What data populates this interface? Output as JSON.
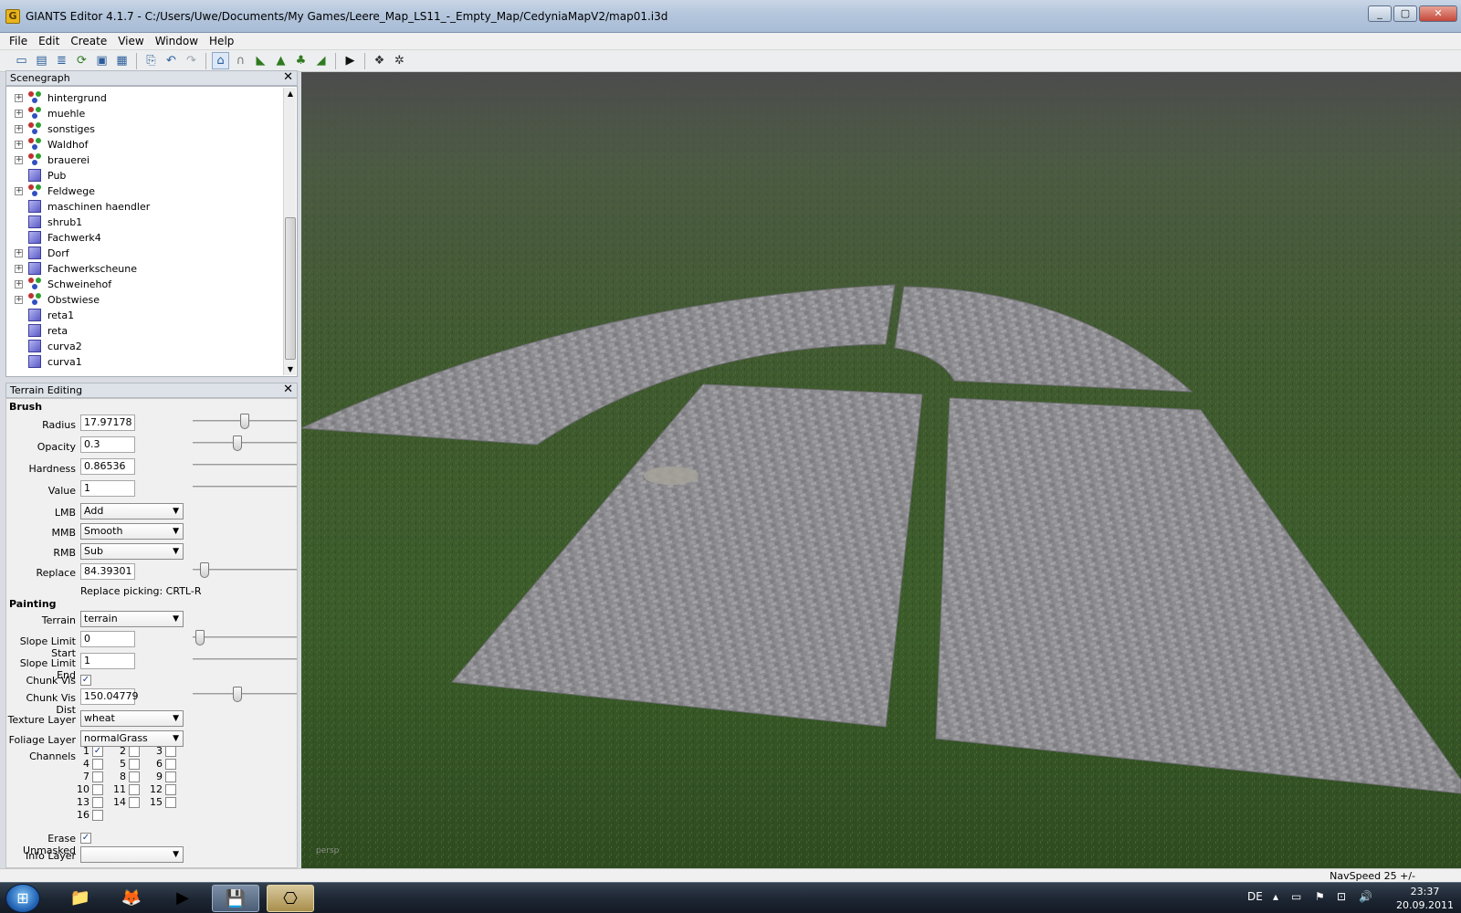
{
  "window": {
    "title": "GIANTS Editor 4.1.7 - C:/Users/Uwe/Documents/My Games/Leere_Map_LS11_-_Empty_Map/CedyniaMapV2/map01.i3d",
    "app_icon": "G"
  },
  "menu": [
    "File",
    "Edit",
    "Create",
    "View",
    "Window",
    "Help"
  ],
  "scenegraph": {
    "title": "Scenegraph",
    "items": [
      {
        "label": "hintergrund",
        "type": "group",
        "expandable": true
      },
      {
        "label": "muehle",
        "type": "group",
        "expandable": true
      },
      {
        "label": "sonstiges",
        "type": "group",
        "expandable": true
      },
      {
        "label": "Waldhof",
        "type": "group",
        "expandable": true
      },
      {
        "label": "brauerei",
        "type": "group",
        "expandable": true
      },
      {
        "label": "Pub",
        "type": "cube",
        "expandable": false
      },
      {
        "label": "Feldwege",
        "type": "group",
        "expandable": true
      },
      {
        "label": "maschinen haendler",
        "type": "cube",
        "expandable": false
      },
      {
        "label": "shrub1",
        "type": "cube",
        "expandable": false
      },
      {
        "label": "Fachwerk4",
        "type": "cube",
        "expandable": false
      },
      {
        "label": "Dorf",
        "type": "cube",
        "expandable": true
      },
      {
        "label": "Fachwerkscheune",
        "type": "cube",
        "expandable": true
      },
      {
        "label": "Schweinehof",
        "type": "group",
        "expandable": true
      },
      {
        "label": "Obstwiese",
        "type": "group",
        "expandable": true
      },
      {
        "label": "reta1",
        "type": "cube",
        "expandable": false
      },
      {
        "label": "reta",
        "type": "cube",
        "expandable": false
      },
      {
        "label": "curva2",
        "type": "cube",
        "expandable": false
      },
      {
        "label": "curva1",
        "type": "cube",
        "expandable": false
      }
    ]
  },
  "terrain": {
    "title": "Terrain Editing",
    "brush_title": "Brush",
    "painting_title": "Painting",
    "radius": {
      "label": "Radius",
      "value": "17.97178"
    },
    "opacity": {
      "label": "Opacity",
      "value": "0.3"
    },
    "hardness": {
      "label": "Hardness",
      "value": "0.86536"
    },
    "value": {
      "label": "Value",
      "value": "1"
    },
    "lmb": {
      "label": "LMB",
      "value": "Add"
    },
    "mmb": {
      "label": "MMB",
      "value": "Smooth"
    },
    "rmb": {
      "label": "RMB",
      "value": "Sub"
    },
    "replace": {
      "label": "Replace",
      "value": "84.39301"
    },
    "replace_hint": "Replace picking: CRTL-R",
    "terrain_layer": {
      "label": "Terrain",
      "value": "terrain"
    },
    "slope_start": {
      "label": "Slope Limit Start",
      "value": "0"
    },
    "slope_end": {
      "label": "Slope Limit End",
      "value": "1"
    },
    "chunk_vis": {
      "label": "Chunk Vis",
      "checked": true
    },
    "chunk_vis_dist": {
      "label": "Chunk Vis Dist",
      "value": "150.04779"
    },
    "texture_layer": {
      "label": "Texture Layer",
      "value": "wheat"
    },
    "foliage_layer": {
      "label": "Foliage Layer",
      "value": "normalGrass"
    },
    "channels_label": "Channels",
    "channels": [
      {
        "n": "1",
        "checked": true
      },
      {
        "n": "2",
        "checked": false
      },
      {
        "n": "3",
        "checked": false
      },
      {
        "n": "4",
        "checked": false
      },
      {
        "n": "5",
        "checked": false
      },
      {
        "n": "6",
        "checked": false
      },
      {
        "n": "7",
        "checked": false
      },
      {
        "n": "8",
        "checked": false
      },
      {
        "n": "9",
        "checked": false
      },
      {
        "n": "10",
        "checked": false
      },
      {
        "n": "11",
        "checked": false
      },
      {
        "n": "12",
        "checked": false
      },
      {
        "n": "13",
        "checked": false
      },
      {
        "n": "14",
        "checked": false
      },
      {
        "n": "15",
        "checked": false
      },
      {
        "n": "16",
        "checked": false
      }
    ],
    "erase_unmasked": {
      "label": "Erase Unmasked",
      "checked": true
    },
    "info_layer": {
      "label": "Info Layer",
      "value": ""
    },
    "slider_levels": {
      "radius": 0.5,
      "opacity": 0.42,
      "replace": 0.08,
      "slope_start": 0.03,
      "chunk_vis_dist": 0.42
    }
  },
  "viewport": {
    "camera_label": "persp"
  },
  "status": {
    "navspeed": "NavSpeed 25 +/-"
  },
  "taskbar": {
    "language": "DE",
    "time": "23:37",
    "date": "20.09.2011"
  },
  "colors": {
    "accent": "#2b5d9a",
    "grass": "#3b5c2a",
    "cobble": "#8a8a8e"
  }
}
